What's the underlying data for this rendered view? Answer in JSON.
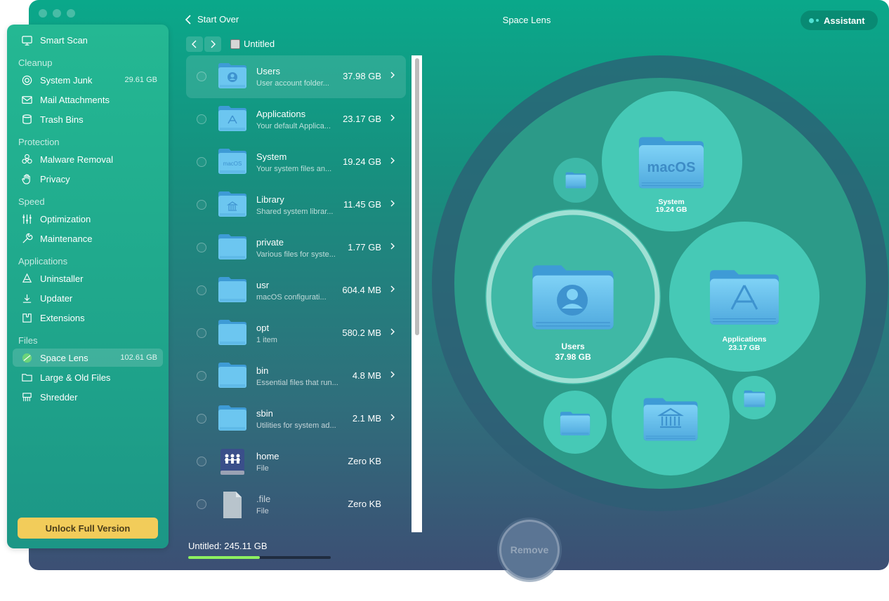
{
  "header": {
    "back_label": "Start Over",
    "title": "Space Lens",
    "assistant_label": "Assistant"
  },
  "breadcrumb": {
    "label": "Untitled"
  },
  "sidebar": {
    "smart_scan": "Smart Scan",
    "sections": {
      "cleanup": "Cleanup",
      "protection": "Protection",
      "speed": "Speed",
      "applications": "Applications",
      "files": "Files"
    },
    "items": {
      "system_junk": {
        "label": "System Junk",
        "size": "29.61 GB"
      },
      "mail_attachments": {
        "label": "Mail Attachments"
      },
      "trash_bins": {
        "label": "Trash Bins"
      },
      "malware_removal": {
        "label": "Malware Removal"
      },
      "privacy": {
        "label": "Privacy"
      },
      "optimization": {
        "label": "Optimization"
      },
      "maintenance": {
        "label": "Maintenance"
      },
      "uninstaller": {
        "label": "Uninstaller"
      },
      "updater": {
        "label": "Updater"
      },
      "extensions": {
        "label": "Extensions"
      },
      "space_lens": {
        "label": "Space Lens",
        "size": "102.61 GB"
      },
      "large_old_files": {
        "label": "Large & Old Files"
      },
      "shredder": {
        "label": "Shredder"
      }
    },
    "unlock_label": "Unlock Full Version"
  },
  "list": [
    {
      "name": "Users",
      "desc": "User account folder...",
      "size": "37.98 GB",
      "icon": "users-folder-icon",
      "chevron": true
    },
    {
      "name": "Applications",
      "desc": "Your default Applica...",
      "size": "23.17 GB",
      "icon": "applications-folder-icon",
      "chevron": true
    },
    {
      "name": "System",
      "desc": "Your system files an...",
      "size": "19.24 GB",
      "icon": "macos-folder-icon",
      "chevron": true
    },
    {
      "name": "Library",
      "desc": "Shared system librar...",
      "size": "11.45 GB",
      "icon": "library-folder-icon",
      "chevron": true
    },
    {
      "name": "private",
      "desc": "Various files for syste...",
      "size": "1.77 GB",
      "icon": "folder-icon",
      "chevron": true
    },
    {
      "name": "usr",
      "desc": "macOS configurati...",
      "size": "604.4 MB",
      "icon": "folder-icon",
      "chevron": true
    },
    {
      "name": "opt",
      "desc": "1 item",
      "size": "580.2 MB",
      "icon": "folder-icon",
      "chevron": true
    },
    {
      "name": "bin",
      "desc": "Essential files that run...",
      "size": "4.8 MB",
      "icon": "folder-icon",
      "chevron": true
    },
    {
      "name": "sbin",
      "desc": "Utilities for system ad...",
      "size": "2.1 MB",
      "icon": "folder-icon",
      "chevron": true
    },
    {
      "name": "home",
      "desc": "File",
      "size": "Zero KB",
      "icon": "home-drive-icon",
      "chevron": false
    },
    {
      "name": ".file",
      "desc": "File",
      "size": "Zero KB",
      "icon": "file-icon",
      "chevron": false
    }
  ],
  "footer": {
    "total_label": "Untitled: 245.11 GB",
    "usage_fraction": 0.5,
    "remove_label": "Remove"
  },
  "bubbles": {
    "system": {
      "name": "System",
      "size": "19.24 GB",
      "badge": "macOS"
    },
    "users": {
      "name": "Users",
      "size": "37.98 GB"
    },
    "applications": {
      "name": "Applications",
      "size": "23.17 GB"
    }
  },
  "colors": {
    "accent": "#f2cc5a",
    "folder": "#6cc6f0",
    "progress": "#8df060"
  }
}
